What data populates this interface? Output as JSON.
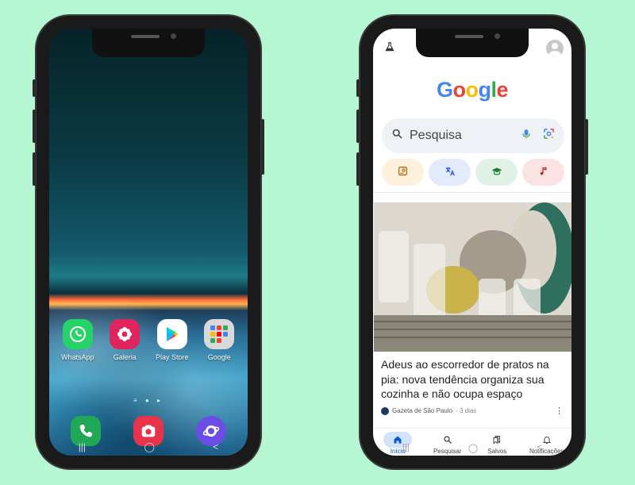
{
  "left_phone": {
    "apps": [
      {
        "label": "WhatsApp",
        "icon": "whatsapp-icon",
        "color": "#25d366"
      },
      {
        "label": "Galeria",
        "icon": "gallery-icon",
        "color": "#e0245e"
      },
      {
        "label": "Play Store",
        "icon": "play-store-icon",
        "color": "#ffffff"
      },
      {
        "label": "Google",
        "icon": "google-folder-icon",
        "color": "#d9d9d9"
      }
    ],
    "dock": [
      {
        "icon": "phone-icon",
        "color": "#1fa855"
      },
      {
        "icon": "camera-icon",
        "color": "#e8344a"
      },
      {
        "icon": "browser-icon",
        "color": "#6b4de6"
      }
    ],
    "nav": [
      "|||",
      "◯",
      "<"
    ]
  },
  "right_phone": {
    "logo": "Google",
    "search": {
      "placeholder": "Pesquisa"
    },
    "chips": [
      {
        "icon": "image-search-icon",
        "color": "#fdf1dc",
        "fg": "#b06000"
      },
      {
        "icon": "translate-icon",
        "color": "#e3ebfb",
        "fg": "#1a56d6"
      },
      {
        "icon": "education-icon",
        "color": "#e2f1e6",
        "fg": "#1e7e34"
      },
      {
        "icon": "music-icon",
        "color": "#fbe3e3",
        "fg": "#c5221f"
      }
    ],
    "article": {
      "headline": "Adeus ao escorredor de pratos na pia: nova tendência organiza sua cozinha e não ocupa espaço",
      "source": "Gazeta de São Paulo",
      "age": "· 3 dias"
    },
    "bottom_nav": [
      {
        "label": "Início",
        "icon": "home-icon",
        "active": true
      },
      {
        "label": "Pesquisar",
        "icon": "search-icon",
        "active": false
      },
      {
        "label": "Salvos",
        "icon": "saved-icon",
        "active": false
      },
      {
        "label": "Notificações",
        "icon": "bell-icon",
        "active": false
      }
    ],
    "nav": [
      "|||",
      "◯",
      "<"
    ]
  }
}
